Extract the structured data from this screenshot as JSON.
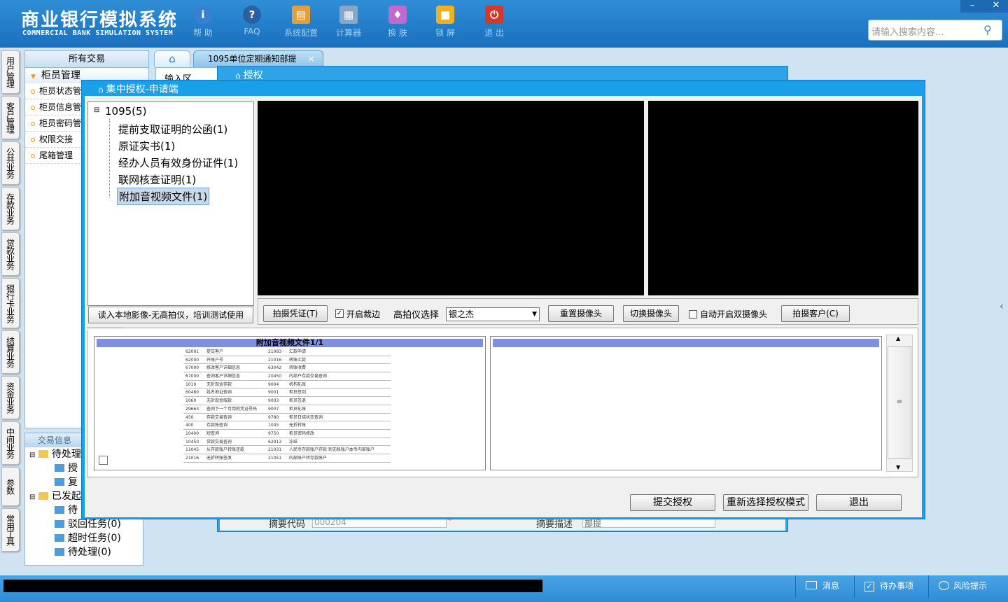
{
  "header": {
    "logo_cn": "商业银行模拟系统",
    "logo_en": "COMMERCIAL BANK SIMULATION SYSTEM",
    "toolbar": [
      {
        "label": "帮 助",
        "icon": "help-icon",
        "color": "#3a7fd0"
      },
      {
        "label": "FAQ",
        "icon": "faq-icon",
        "color": "#2a5fa0"
      },
      {
        "label": "系统配置",
        "icon": "system-config-icon",
        "color": "#e0a040"
      },
      {
        "label": "计算器",
        "icon": "calculator-icon",
        "color": "#8aa6c4"
      },
      {
        "label": "换 肤",
        "icon": "skin-icon",
        "color": "#c06ad0"
      },
      {
        "label": "锁 屏",
        "icon": "lock-icon",
        "color": "#f0b020"
      },
      {
        "label": "退 出",
        "icon": "exit-icon",
        "color": "#d03a2a"
      }
    ],
    "search_placeholder": "请输入搜索内容..."
  },
  "left_nav": [
    "用户管理",
    "客户管理",
    "公共业务",
    "存款业务",
    "贷款业务",
    "银行卡业务",
    "结算业务",
    "资金业务",
    "中间业务",
    "参数",
    "常用工具"
  ],
  "sidebar": {
    "header": "所有交易",
    "section": "柜员管理",
    "items": [
      "柜员状态管",
      "柜员信息管",
      "柜员密码管",
      "权限交接",
      "尾箱管理"
    ]
  },
  "tx_info": {
    "header": "交易信息",
    "nodes": [
      "待处理",
      "授",
      "复",
      "已发起",
      "待",
      "驳回任务(0)",
      "超时任务(0)",
      "待处理(0)"
    ]
  },
  "tabs": {
    "home": "⌂",
    "active": "1095单位定期通知部提",
    "close": "×"
  },
  "behind": {
    "input_label": "输入区",
    "auth_title": "授权",
    "summary_code_label": "摘要代码",
    "summary_code_value": "000204",
    "summary_desc_label": "摘要描述",
    "summary_desc_value": "部提"
  },
  "dialog": {
    "title": "集中授权-申请端",
    "tree_root": "1095(5)",
    "tree_items": [
      "提前支取证明的公函(1)",
      "原证实书(1)",
      "经办人员有效身份证件(1)",
      "联网核查证明(1)",
      "附加音视频文件(1)"
    ],
    "read_local_button": "读入本地影像-无高拍仪，培训测试使用",
    "capture_voucher": "拍摄凭证(T)",
    "crop_label": "开启裁边",
    "scanner_label": "高拍仪选择",
    "scanner_value": "银之杰",
    "reset_camera": "重置摄像头",
    "switch_camera": "切换摄像头",
    "auto_dual_label": "自动开启双摄像头",
    "capture_customer": "拍摄客户(C)",
    "thumb_title": "附加音视频文件1/1",
    "submit": "提交授权",
    "reselect": "重新选择授权模式",
    "exit": "退出"
  },
  "doc_rows": [
    [
      "62001",
      "提交客户",
      "21093",
      "汇款申请"
    ],
    [
      "62000",
      "开账户号",
      "21016",
      "转账汇款"
    ],
    [
      "67000",
      "修改客户详细信息",
      "63042",
      "转账收费"
    ],
    [
      "67000",
      "查询客户详细信息",
      "20450",
      "内部户存款交易查询"
    ],
    [
      "1010",
      "无折现金存款",
      "9004",
      "机构轧账"
    ],
    [
      "60480",
      "姓名地址查询",
      "9001",
      "柜员签到"
    ],
    [
      "1060",
      "无折现金取款",
      "9003",
      "柜员签退"
    ],
    [
      "29663",
      "查询下一个可用的凭证号码",
      "9007",
      "柜员轧账"
    ],
    [
      "450",
      "存款交易查询",
      "9780",
      "柜员日结状态查询"
    ],
    [
      "400",
      "存款账查询",
      "1045",
      "无折转账"
    ],
    [
      "10400",
      "短查询",
      "9750",
      "柜员密码修改"
    ],
    [
      "10450",
      "贷款交易查询",
      "62913",
      "冻结"
    ],
    [
      "11045",
      "从存款账户转账还款",
      "21031",
      "人民币存款账户存款 到无帐账户本币内部账户"
    ],
    [
      "21016",
      "无折转账签发",
      "21051",
      "内部账户转存款账户"
    ]
  ],
  "statusbar": {
    "message": "消息",
    "todo": "待办事项",
    "risk": "风险提示"
  }
}
